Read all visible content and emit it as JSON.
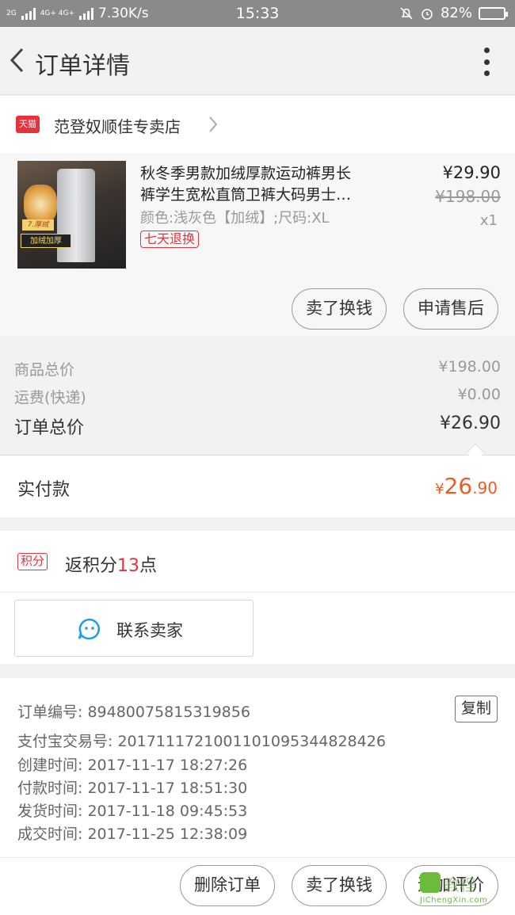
{
  "status_bar": {
    "net_left": "2G",
    "net_mid": "4G+ 4G+",
    "net_mid2": "2G",
    "speed": "7.30K/s",
    "time": "15:33",
    "battery": "82%",
    "battery_level": 0.82
  },
  "nav": {
    "title": "订单详情"
  },
  "shop": {
    "badge": "天猫",
    "name": "范登奴顺佳专卖店"
  },
  "item": {
    "title_line1": "秋冬季男款加绒厚款运动裤男长",
    "title_line2": "裤学生宽松直筒卫裤大码男士…",
    "sku": "颜色:浅灰色【加绒】;尺码:XL",
    "return_tag": "七天退换",
    "price": "¥29.90",
    "original_price": "¥198.00",
    "quantity": "x1",
    "thumb_badge": "加绒加厚",
    "thumb_badge2": "7.厚绒",
    "btn_sell": "卖了换钱",
    "btn_aftersale": "申请售后"
  },
  "summary": {
    "goods_label": "商品总价",
    "goods_value": "¥198.00",
    "shipping_label": "运费(快递)",
    "shipping_value": "¥0.00",
    "total_label": "订单总价",
    "total_value": "¥26.90"
  },
  "paid": {
    "label": "实付款",
    "currency": "¥",
    "int": "26",
    "dec": ".90"
  },
  "points": {
    "tag": "积分",
    "prefix": "返积分",
    "num": "13",
    "suffix": "点"
  },
  "contact": {
    "label": "联系卖家"
  },
  "info": {
    "order_no": "订单编号: 89480075815319856",
    "alipay_no": "支付宝交易号: 2017111721001101095344828426",
    "created": "创建时间: 2017-11-17 18:27:26",
    "paid": "付款时间: 2017-11-17 18:51:30",
    "shipped": "发货时间: 2017-11-18 09:45:53",
    "completed": "成交时间: 2017-11-25 12:38:09",
    "copy": "复制"
  },
  "bottom": {
    "delete": "删除订单",
    "sell": "卖了换钱",
    "review": "追加评价"
  },
  "watermark": {
    "text": "教程",
    "url": "JiChengXin.com"
  },
  "colors": {
    "accent_red": "#e5323b",
    "price_orange": "#f05a23",
    "contact_blue": "#1da1e6"
  }
}
